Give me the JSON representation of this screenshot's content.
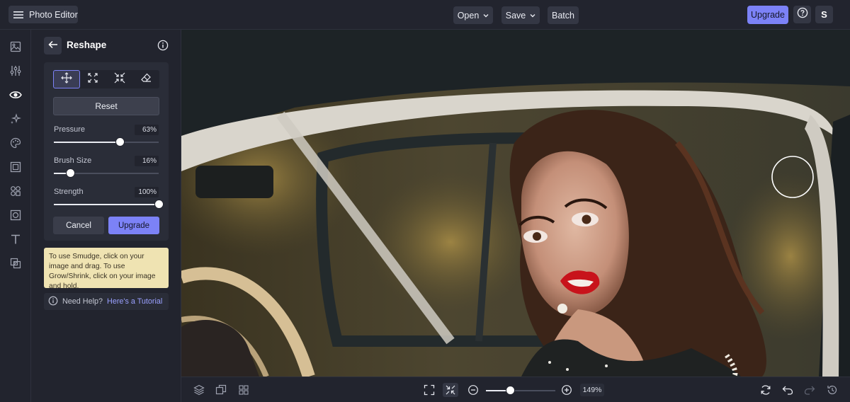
{
  "topbar": {
    "app_name": "Photo Editor",
    "open_label": "Open",
    "save_label": "Save",
    "batch_label": "Batch",
    "upgrade_label": "Upgrade",
    "avatar_initial": "S"
  },
  "rail": {
    "icons": [
      "image-icon",
      "adjust-sliders-icon",
      "eye-icon",
      "sparkle-effects-icon",
      "palette-icon",
      "frame-icon",
      "graphics-icon",
      "crop-overlay-icon",
      "text-icon",
      "layers-textures-icon"
    ],
    "active_index": 2
  },
  "panel": {
    "title": "Reshape",
    "tools": [
      "smudge-tool-icon",
      "grow-tool-icon",
      "shrink-tool-icon",
      "eraser-tool-icon"
    ],
    "active_tool_index": 0,
    "reset_label": "Reset",
    "sliders": [
      {
        "label": "Pressure",
        "value_text": "63%",
        "fraction": 0.63
      },
      {
        "label": "Brush Size",
        "value_text": "16%",
        "fraction": 0.16
      },
      {
        "label": "Strength",
        "value_text": "100%",
        "fraction": 1.0
      }
    ],
    "cancel_label": "Cancel",
    "upgrade_label": "Upgrade",
    "tip_text": "To use Smudge, click on your image and drag. To use Grow/Shrink, click on your image and hold.",
    "help_text": "Need Help?",
    "help_link": "Here's a Tutorial"
  },
  "bottombar": {
    "zoom_text": "149%",
    "zoom_fraction": 0.35
  },
  "colors": {
    "accent": "#7c82f7",
    "background": "#22242e",
    "tip_background": "#efe3b2"
  }
}
